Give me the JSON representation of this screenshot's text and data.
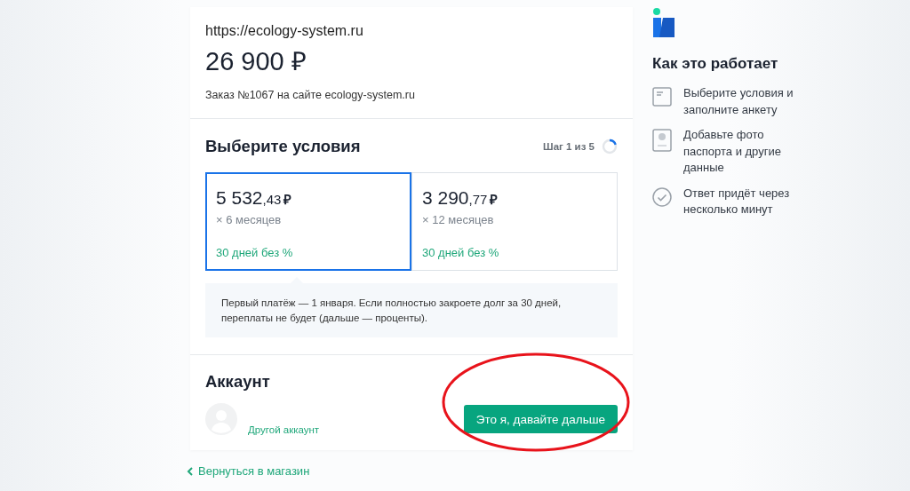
{
  "order": {
    "site_url": "https://ecology-system.ru",
    "amount": "26 900 ₽",
    "description": "Заказ №1067 на сайте ecology-system.ru"
  },
  "conditions": {
    "title": "Выберите условия",
    "step": "Шаг 1 из 5",
    "options": [
      {
        "whole": "5 532",
        "fraction": ",43",
        "currency": "₽",
        "term": "× 6 месяцев",
        "promo": "30 дней без %",
        "selected": true
      },
      {
        "whole": "3 290",
        "fraction": ",77",
        "currency": "₽",
        "term": "× 12 месяцев",
        "promo": "30 дней без %",
        "selected": false
      }
    ],
    "note": "Первый платёж — 1 января. Если полностью закроете долг за 30 дней, переплаты не будет (дальше — проценты)."
  },
  "account": {
    "title": "Аккаунт",
    "switch_link": "Другой аккаунт",
    "continue_button": "Это я, давайте дальше"
  },
  "back_link": "Вернуться в магазин",
  "how_it_works": {
    "title": "Как это работает",
    "steps": [
      {
        "kind": "form",
        "text": "Выберите условия и заполните анкету"
      },
      {
        "kind": "passport",
        "text": "Добавьте фото паспорта и другие данные"
      },
      {
        "kind": "check",
        "text": "Ответ придёт через несколько минут"
      }
    ]
  }
}
